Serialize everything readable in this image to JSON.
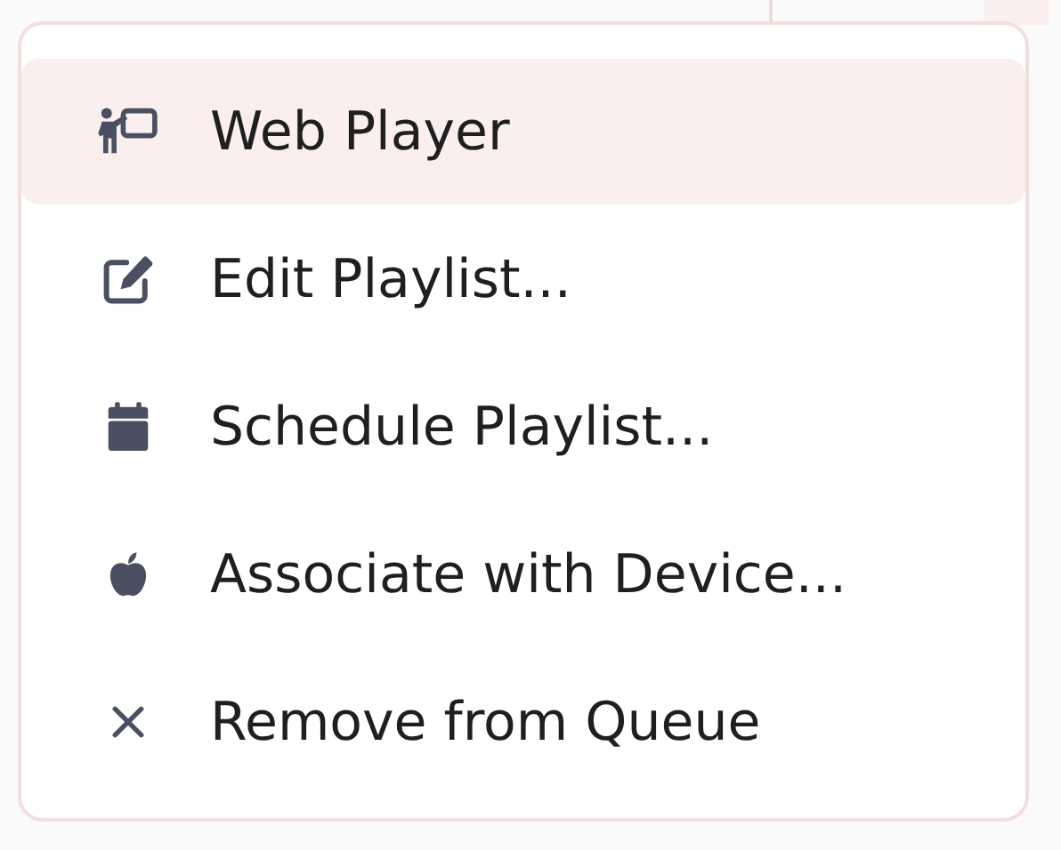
{
  "menu": {
    "items": [
      {
        "label": "Web Player",
        "selected": true
      },
      {
        "label": "Edit Playlist...",
        "selected": false
      },
      {
        "label": "Schedule Playlist...",
        "selected": false
      },
      {
        "label": "Associate with Device...",
        "selected": false
      },
      {
        "label": "Remove from Queue",
        "selected": false
      }
    ]
  }
}
